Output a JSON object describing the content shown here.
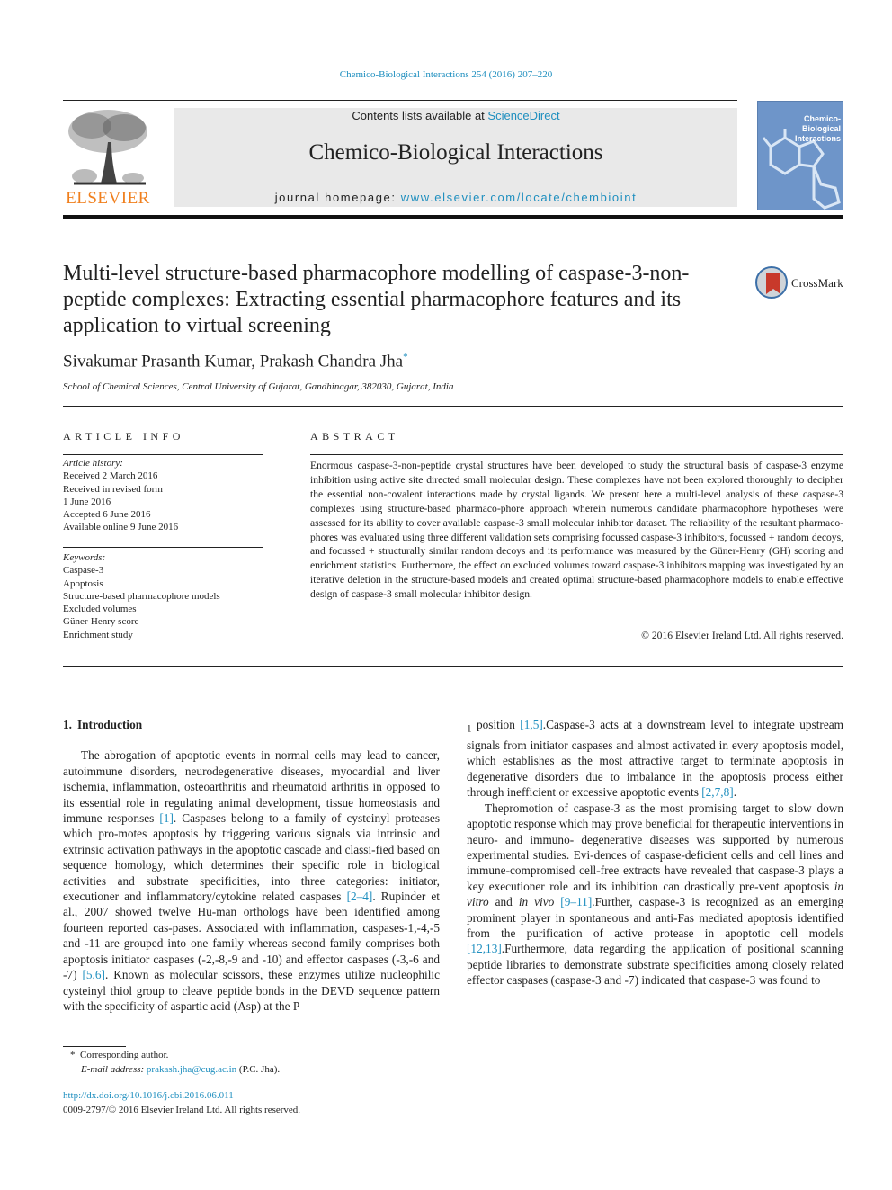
{
  "header": {
    "running_head": "Chemico-Biological Interactions 254 (2016) 207–220",
    "publisher_logo_text": "ELSEVIER",
    "contents_prefix": "Contents lists available at ",
    "contents_link": "ScienceDirect",
    "journal_name": "Chemico-Biological Interactions",
    "homepage_prefix": "journal homepage: ",
    "homepage_link": "www.elsevier.com/locate/chembioint",
    "cover_title": "Chemico-Biological Interactions"
  },
  "article": {
    "title": "Multi-level structure-based pharmacophore modelling of caspase-3-non-peptide complexes: Extracting essential pharmacophore features and its application to virtual screening",
    "crossmark_label": "CrossMark",
    "authors": "Sivakumar Prasanth Kumar, Prakash Chandra Jha",
    "author_mark": "*",
    "affiliation": "School of Chemical Sciences, Central University of Gujarat, Gandhinagar, 382030, Gujarat, India"
  },
  "article_info": {
    "heading": "ARTICLE INFO",
    "history_label": "Article history:",
    "history": [
      "Received 2 March 2016",
      "Received in revised form",
      "1 June 2016",
      "Accepted 6 June 2016",
      "Available online 9 June 2016"
    ],
    "keywords_label": "Keywords:",
    "keywords": [
      "Caspase-3",
      "Apoptosis",
      "Structure-based pharmacophore models",
      "Excluded volumes",
      "Güner-Henry score",
      "Enrichment study"
    ]
  },
  "abstract": {
    "heading": "ABSTRACT",
    "text": "Enormous caspase-3-non-peptide crystal structures have been developed to study the structural basis of caspase-3 enzyme inhibition using active site directed small molecular design. These complexes have not been explored thoroughly to decipher the essential non-covalent interactions made by crystal ligands. We present here a multi-level analysis of these caspase-3 complexes using structure-based pharmaco-phore approach wherein numerous candidate pharmacophore hypotheses were assessed for its ability to cover available caspase-3 small molecular inhibitor dataset. The reliability of the resultant pharmaco-phores was evaluated using three different validation sets comprising focussed caspase-3 inhibitors, focussed + random decoys, and focussed + structurally similar random decoys and its performance was measured by the Güner-Henry (GH) scoring and enrichment statistics. Furthermore, the effect on excluded volumes toward caspase-3 inhibitors mapping was investigated by an iterative deletion in the structure-based models and created optimal structure-based pharmacophore models to enable effective design of caspase-3 small molecular inhibitor design.",
    "copyright": "© 2016 Elsevier Ireland Ltd. All rights reserved."
  },
  "introduction": {
    "number": "1.",
    "heading": "Introduction",
    "p1": [
      {
        "t": "The abrogation of apoptotic events in normal cells may lead to cancer, autoimmune disorders, neurodegenerative diseases, myocardial and liver ischemia, inflammation, osteoarthritis and rheumatoid arthritis in opposed to its essential role in regulating animal development, tissue homeostasis and immune responses "
      },
      {
        "ref": "[1]"
      },
      {
        "t": ". Caspases belong to a family of cysteinyl proteases which pro-motes apoptosis by triggering various signals via intrinsic and extrinsic activation pathways in the apoptotic cascade and classi-fied based on sequence homology, which determines their specific role in biological activities and substrate specificities, into three categories: initiator, executioner and inflammatory/cytokine related caspases "
      },
      {
        "ref": "[2–4]"
      },
      {
        "t": ". Rupinder et al., 2007 showed twelve Hu-man orthologs have been identified among fourteen reported cas-pases. Associated with inflammation, caspases-1,-4,-5 and -11 are grouped into one family whereas second family comprises both apoptosis initiator caspases (-2,-8,-9 and -10) and effector caspases (-3,-6 and -7) "
      },
      {
        "ref": "[5,6]"
      },
      {
        "t": ". Known as molecular scissors, these enzymes utilize nucleophilic cysteinyl thiol group to cleave peptide bonds in the DEVD sequence pattern with the specificity of aspartic acid (Asp) at the P"
      },
      {
        "sub": "1"
      },
      {
        "t": " position "
      },
      {
        "ref": "[1,5]"
      },
      {
        "t": ". Caspase-3 acts at a downstream level to integrate upstream signals from initiator caspases and almost activated in every apoptosis model, which establishes as the most attractive target to terminate apoptosis in degenerative disorders due to imbalance in the apoptosis process either through inefficient or excessive apoptotic events "
      },
      {
        "ref": "[2,7,8]"
      },
      {
        "t": "."
      }
    ],
    "p2": [
      {
        "t": "The promotion of caspase-3 as the most promising target to slow down apoptotic response which may prove beneficial for therapeutic interventions in neuro- and immuno- degenerative diseases was supported by numerous experimental studies. Evi-dences of caspase-deficient cells and cell lines and immune-compromised cell-free extracts have revealed that caspase-3 plays a key executioner role and its inhibition can drastically pre-vent apoptosis "
      },
      {
        "i": "in vitro"
      },
      {
        "t": " and "
      },
      {
        "i": "in vivo"
      },
      {
        "t": " "
      },
      {
        "ref": "[9–11]"
      },
      {
        "t": ". Further, caspase-3 is recognized as an emerging prominent player in spontaneous and anti-Fas mediated apoptosis identified from the purification of active protease in apoptotic cell models "
      },
      {
        "ref": "[12,13]"
      },
      {
        "t": ". Furthermore, data regarding the application of positional scanning peptide libraries to demonstrate substrate specificities among closely related effector caspases (caspase-3 and -7) indicated that caspase-3 was found to"
      }
    ]
  },
  "footnote": {
    "mark": "*",
    "corresponding": "Corresponding author.",
    "email_label": "E-mail address:",
    "email": "prakash.jha@cug.ac.in",
    "email_suffix": " (P.C. Jha).",
    "doi": "http://dx.doi.org/10.1016/j.cbi.2016.06.011",
    "issn_copyright": "0009-2797/© 2016 Elsevier Ireland Ltd. All rights reserved."
  }
}
